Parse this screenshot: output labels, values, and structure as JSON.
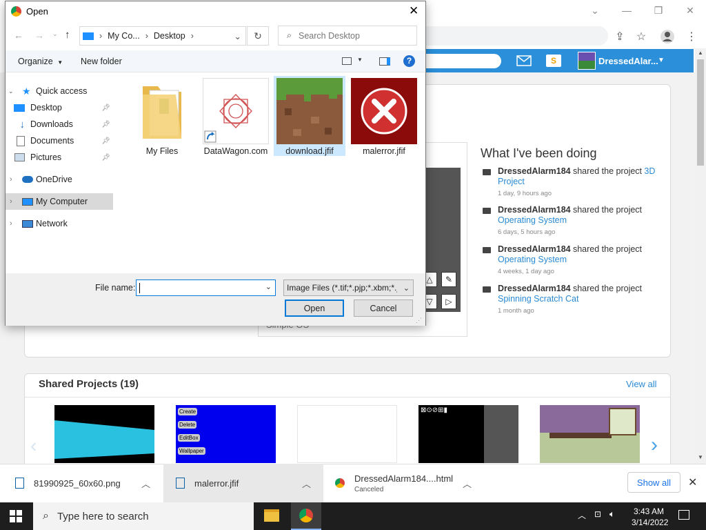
{
  "browser": {
    "toolbar_icons": [
      "share-icon",
      "star-icon",
      "profile-icon",
      "menu-icon"
    ],
    "window_controls": [
      "chevron-down-icon",
      "minimize-icon",
      "restore-icon",
      "close-icon"
    ]
  },
  "scratch": {
    "username": "DressedAlar...",
    "activity_title": "What I've been doing",
    "activity": [
      {
        "user": "DressedAlarm184",
        "action": "shared the project",
        "project": "3D Project",
        "time": "1 day, 9 hours ago"
      },
      {
        "user": "DressedAlarm184",
        "action": "shared the project",
        "project": "Operating System",
        "time": "6 days, 5 hours ago"
      },
      {
        "user": "DressedAlarm184",
        "action": "shared the project",
        "project": "Operating System",
        "time": "4 weeks, 1 day ago"
      },
      {
        "user": "DressedAlarm184",
        "action": "shared the project",
        "project": "Spinning Scratch Cat",
        "time": "1 month ago"
      }
    ],
    "shared_title": "Shared Projects (19)",
    "view_all": "View all",
    "thumb_menu": [
      "Create",
      "Delete",
      "EditBox",
      "Wallpaper"
    ],
    "partial_caption": "Simple OS"
  },
  "downloads": {
    "items": [
      {
        "name": "81990925_60x60.png",
        "status": ""
      },
      {
        "name": "malerror.jfif",
        "status": ""
      },
      {
        "name": "DressedAlarm184....html",
        "status": "Canceled"
      }
    ],
    "show_all": "Show all"
  },
  "taskbar": {
    "search_placeholder": "Type here to search",
    "time": "3:43 AM",
    "date": "3/14/2022"
  },
  "dialog": {
    "title": "Open",
    "breadcrumb": [
      "My Co...",
      "Desktop"
    ],
    "search_placeholder": "Search Desktop",
    "organize": "Organize",
    "new_folder": "New folder",
    "nav": [
      {
        "label": "Quick access",
        "icon": "star-icon"
      },
      {
        "label": "Desktop",
        "icon": "desktop-icon"
      },
      {
        "label": "Downloads",
        "icon": "download-icon"
      },
      {
        "label": "Documents",
        "icon": "document-icon"
      },
      {
        "label": "Pictures",
        "icon": "picture-icon"
      },
      {
        "label": "OneDrive",
        "icon": "cloud-icon"
      },
      {
        "label": "My Computer",
        "icon": "computer-icon"
      },
      {
        "label": "Network",
        "icon": "network-icon"
      }
    ],
    "files": [
      {
        "name": "My Files",
        "icon": "folder-icon"
      },
      {
        "name": "DataWagon.com",
        "icon": "shortcut-icon"
      },
      {
        "name": "download.jfif",
        "icon": "image-icon"
      },
      {
        "name": "malerror.jfif",
        "icon": "error-image-icon"
      }
    ],
    "file_name_label": "File name:",
    "file_name_value": "",
    "file_type": "Image Files (*.tif;*.pjp;*.xbm;*.jxl;*.svgz;*.jpg;*.jpeg;*.ico;*.tiff;*.gif;*.svg;*.jfif;*.webp;*.png;*.bmp;*.pjpeg;*.avif)",
    "open_label": "Open",
    "cancel_label": "Cancel"
  },
  "colors": {
    "accent": "#0078d7",
    "scratch_blue": "#2b90d9",
    "link": "#2a8ad4"
  }
}
